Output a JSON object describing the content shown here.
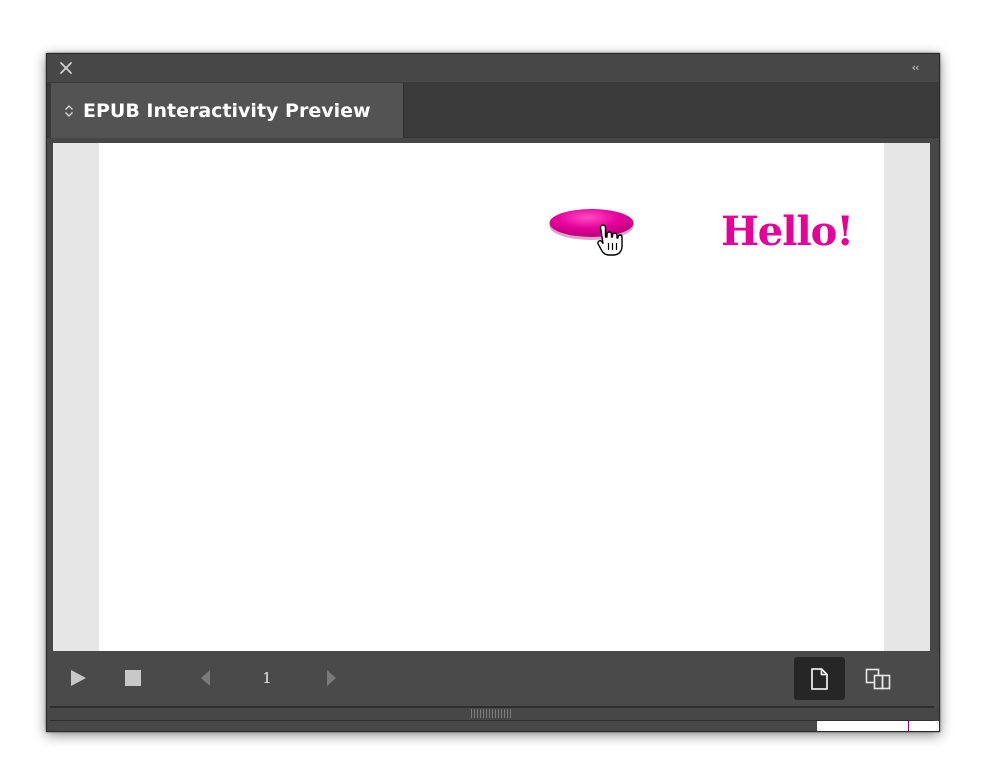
{
  "window": {
    "close_icon": "close-icon",
    "collapse_label": "‹‹"
  },
  "tab": {
    "title": "EPUB Interactivity Preview",
    "chevron_icon": "up-down-chevron-icon"
  },
  "preview": {
    "button_color": "#e5009a",
    "hello_text": "Hello!",
    "text_color": "#e5009a",
    "cursor_icon": "hand-pointer-icon"
  },
  "controls": {
    "play_icon": "play-icon",
    "stop_icon": "stop-icon",
    "prev_icon": "previous-page-icon",
    "next_icon": "next-page-icon",
    "page_number": "1",
    "single_page_view_icon": "single-page-icon",
    "spread_view_icon": "spread-pages-icon"
  },
  "colors": {
    "panel_bg": "#474747",
    "tab_bg": "#535353",
    "viewer_bg": "#e6e6e6",
    "accent_magenta": "#e5009a"
  }
}
